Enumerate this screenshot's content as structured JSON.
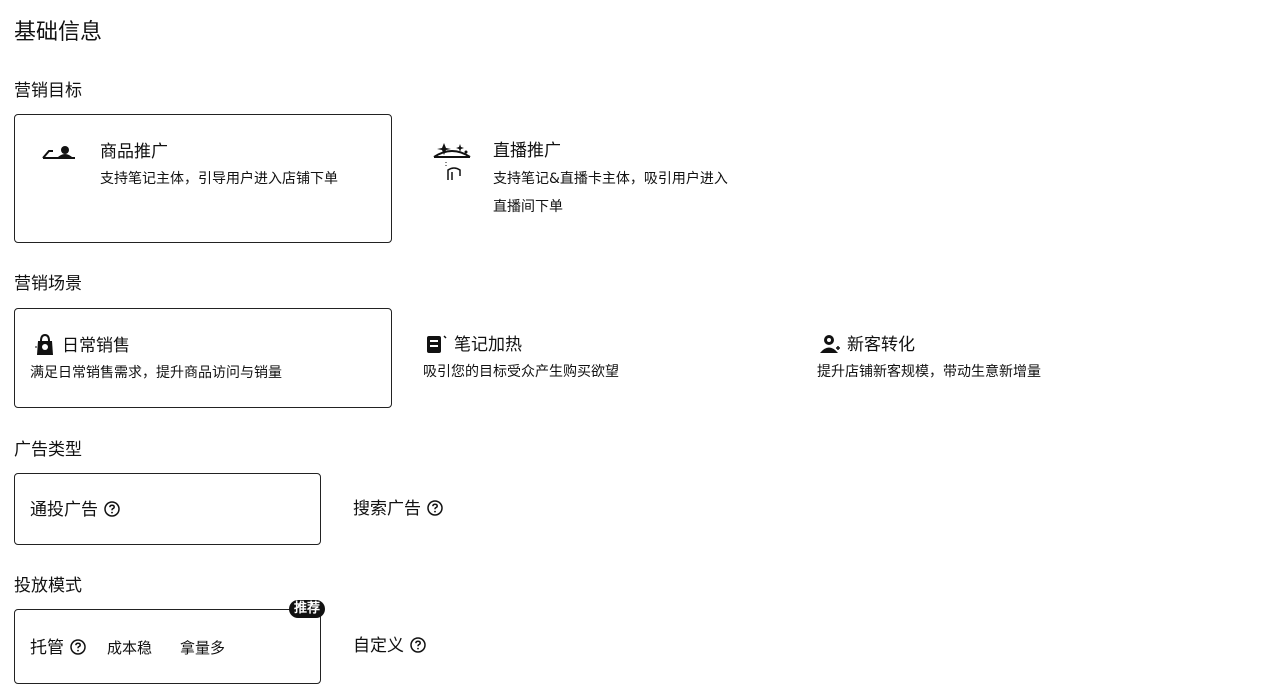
{
  "page": {
    "title": "基础信息"
  },
  "marketing_goal": {
    "title": "营销目标",
    "options": [
      {
        "title": "商品推广",
        "desc": "支持笔记主体，引导用户进入店铺下单",
        "icon": "product-promo-icon",
        "selected": true
      },
      {
        "title": "直播推广",
        "desc_line1": "支持笔记&直播卡主体，吸引用户进入",
        "desc_line2": "直播间下单",
        "icon": "live-promo-icon",
        "selected": false
      }
    ]
  },
  "marketing_scene": {
    "title": "营销场景",
    "options": [
      {
        "title": "日常销售",
        "desc": "满足日常销售需求，提升商品访问与销量",
        "icon": "shopping-bag-icon",
        "selected": true
      },
      {
        "title": "笔记加热",
        "desc": "吸引您的目标受众产生购买欲望",
        "icon": "note-icon",
        "selected": false
      },
      {
        "title": "新客转化",
        "desc": "提升店铺新客规模，带动生意新增量",
        "icon": "new-customer-icon",
        "selected": false
      }
    ]
  },
  "ad_type": {
    "title": "广告类型",
    "options": [
      {
        "label": "通投广告",
        "selected": true
      },
      {
        "label": "搜索广告",
        "selected": false
      }
    ]
  },
  "delivery_mode": {
    "title": "投放模式",
    "options": [
      {
        "label": "托管",
        "tags": [
          "成本稳",
          "拿量多"
        ],
        "badge": "推荐",
        "selected": true
      },
      {
        "label": "自定义",
        "selected": false
      }
    ]
  },
  "colors": {
    "text": "#111111",
    "border": "#222222",
    "badge_bg": "#111111",
    "badge_text": "#ffffff"
  }
}
